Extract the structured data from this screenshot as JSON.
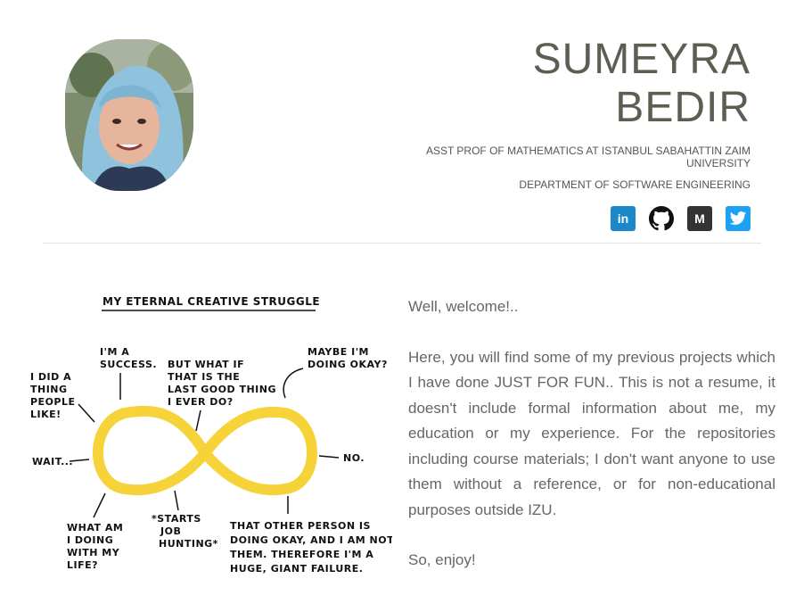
{
  "profile": {
    "name_line1": "SUMEYRA",
    "name_line2": "BEDIR",
    "title": "ASST PROF OF MATHEMATICS AT ISTANBUL SABAHATTIN ZAIM UNIVERSITY",
    "department": "DEPARTMENT OF SOFTWARE ENGINEERING"
  },
  "socials": [
    {
      "icon": "linkedin-icon",
      "label": "in",
      "color": "#1c87c9"
    },
    {
      "icon": "github-icon",
      "color": "#111111"
    },
    {
      "icon": "medium-icon",
      "label": "M",
      "color": "#333333"
    },
    {
      "icon": "twitter-icon",
      "color": "#1da1f2"
    }
  ],
  "comic": {
    "title": "MY ETERNAL CREATIVE STRUGGLE",
    "labels": [
      "I DID A",
      "THING",
      "PEOPLE",
      "LIKE!",
      "I'M A",
      "SUCCESS.",
      "BUT WHAT IF",
      "THAT IS THE",
      "LAST GOOD THING",
      "I EVER DO?",
      "MAYBE I'M",
      "DOING OKAY?",
      "WAIT...",
      "NO.",
      "WHAT AM",
      "I DOING",
      "WITH MY",
      "LIFE?",
      "*STARTS",
      "JOB",
      "HUNTING*",
      "THAT OTHER PERSON IS",
      "DOING OKAY, AND I AM NOT",
      "THEM. THEREFORE I'M A",
      "HUGE, GIANT FAILURE."
    ],
    "loop_color": "#f7d33a"
  },
  "intro": {
    "greeting": "Well, welcome!..",
    "body": "Here, you will find some of my previous projects which I have done JUST FOR FUN.. This is not a resume, it doesn't include formal information about me, my education or my experience. For the repositories including course materials; I don't want anyone to use them without a reference, or for non-educational purposes outside IZU.",
    "closing": "So, enjoy!"
  }
}
